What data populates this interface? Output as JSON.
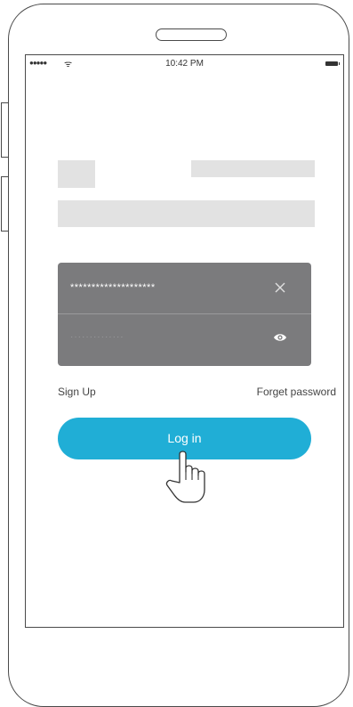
{
  "status_bar": {
    "signal": "●●●●●",
    "wifi": "ᯤ",
    "time": "10:42 PM"
  },
  "login": {
    "password_value": "********************",
    "password_placeholder": "··············",
    "sign_up_label": "Sign Up",
    "forget_password_label": "Forget password",
    "login_button_label": "Log in"
  },
  "colors": {
    "accent": "#20aed6",
    "input_panel": "#7b7b7d",
    "placeholder_block": "#e2e2e2"
  },
  "icons": [
    "clear-icon",
    "eye-icon",
    "pointer-hand-icon",
    "battery-icon",
    "wifi-icon"
  ]
}
